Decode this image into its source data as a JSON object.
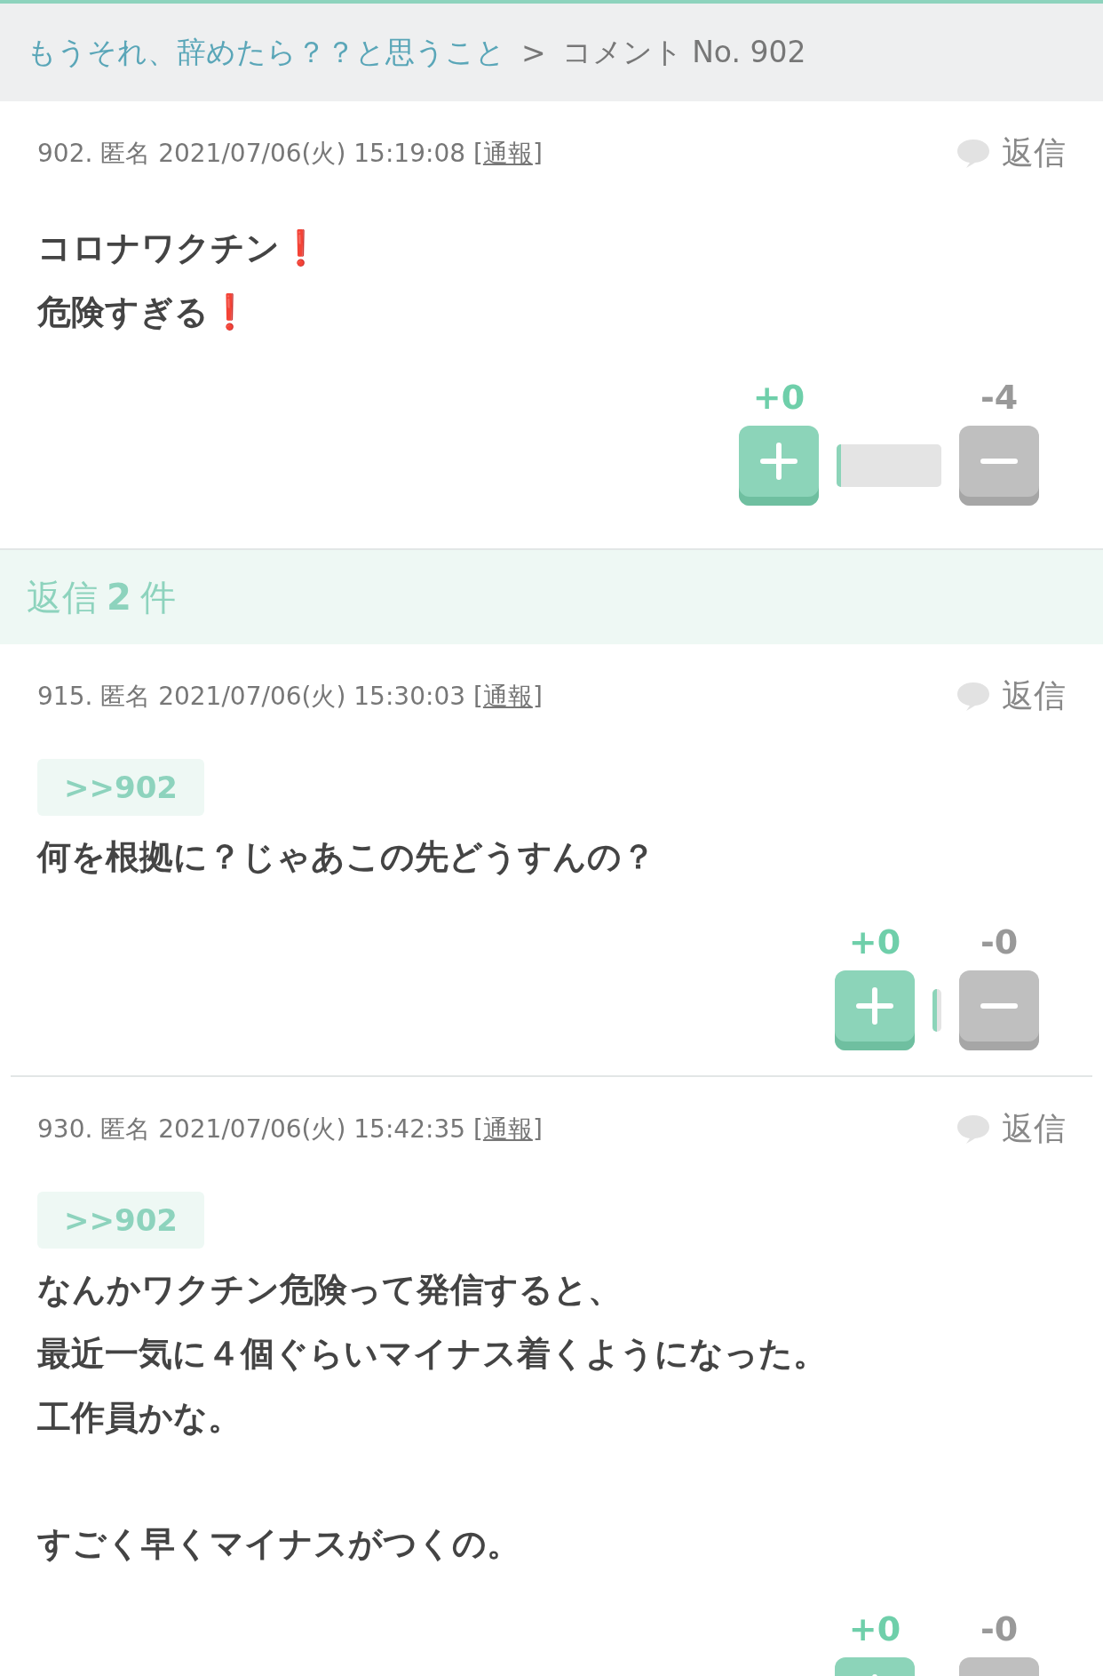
{
  "breadcrumb": {
    "link": "もうそれ、辞めたら？？と思うこと",
    "separator": ">",
    "current": "コメント No. 902"
  },
  "main_comment": {
    "meta": "902. 匿名 2021/07/06(火) 15:19:08",
    "brackets": [
      "[",
      "]"
    ],
    "report": "通報",
    "reply": "返信",
    "paragraphs": [
      [
        "コロナワクチン❗️",
        "危険すぎる❗️"
      ]
    ],
    "votes": {
      "plus": "+0",
      "minus": "-4",
      "kind": "voted"
    }
  },
  "replies_header": {
    "label": "返信",
    "count": "2",
    "unit": "件"
  },
  "replies": [
    {
      "meta": "915. 匿名 2021/07/06(火) 15:30:03",
      "brackets": [
        "[",
        "]"
      ],
      "report": "通報",
      "reply": "返信",
      "quote": ">>902",
      "paragraphs": [
        [
          "何を根拠に？じゃあこの先どうすんの？"
        ]
      ],
      "votes": {
        "plus": "+0",
        "minus": "-0",
        "kind": "unvoted"
      }
    },
    {
      "meta": "930. 匿名 2021/07/06(火) 15:42:35",
      "brackets": [
        "[",
        "]"
      ],
      "report": "通報",
      "reply": "返信",
      "quote": ">>902",
      "paragraphs": [
        [
          "なんかワクチン危険って発信すると、",
          "最近一気に４個ぐらいマイナス着くようになった。",
          "工作員かな。"
        ],
        [
          "すごく早くマイナスがつくの。"
        ]
      ],
      "votes": {
        "plus": "+0",
        "minus": "-0",
        "kind": "unvoted"
      }
    }
  ]
}
